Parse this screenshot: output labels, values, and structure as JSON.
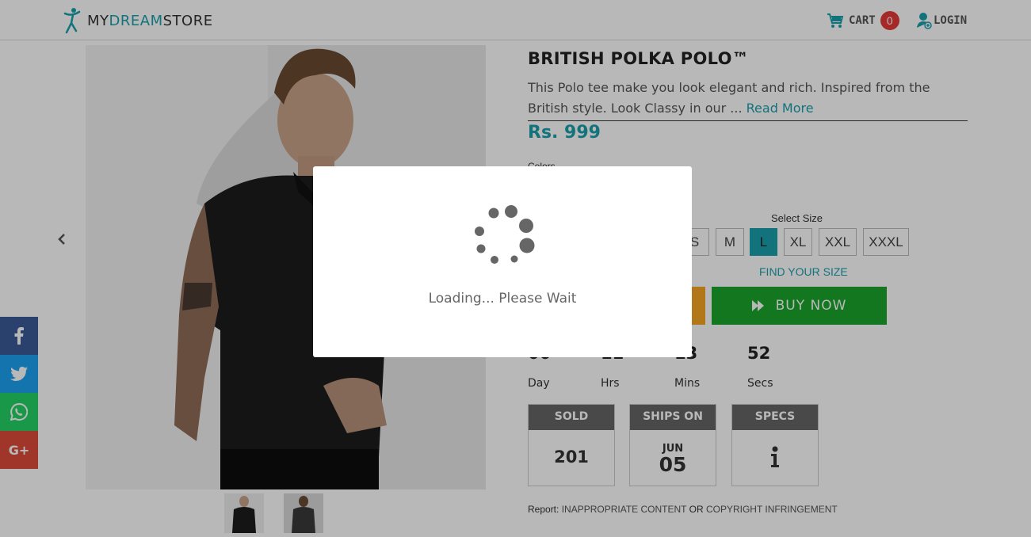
{
  "header": {
    "logo": {
      "my": "MY",
      "dream": "DREAM",
      "store": "STORE"
    },
    "cart_label": "CART",
    "cart_count": "0",
    "login_label": "LOGIN"
  },
  "product": {
    "title": "BRITISH POLKA POLO™",
    "description": "This Polo tee make you look elegant and rich. Inspired from the British style.  Look Classy in our ... ",
    "read_more": "Read More",
    "price": "Rs. 999",
    "colors_label": "Colors",
    "size_label": "Select Size",
    "sizes": [
      "S",
      "M",
      "L",
      "XL",
      "XXL",
      "XXXL"
    ],
    "selected_size": "L",
    "find_size": "FIND YOUR SIZE",
    "buy_now": "BUY NOW"
  },
  "timer": {
    "values": [
      "00",
      "11",
      "13",
      "52"
    ],
    "units": [
      "Day",
      "Hrs",
      "Mins",
      "Secs"
    ]
  },
  "info": {
    "sold_label": "SOLD",
    "sold_value": "201",
    "ships_label": "SHIPS ON",
    "ships_month": "JUN",
    "ships_day": "05",
    "specs_label": "SPECS"
  },
  "report": {
    "label": "Report:",
    "inappropriate": "INAPPROPRIATE CONTENT",
    "or": "OR",
    "copyright": "COPYRIGHT INFRINGEMENT"
  },
  "social": [
    "facebook-icon",
    "twitter-icon",
    "whatsapp-icon",
    "google-plus-icon"
  ],
  "modal": {
    "loading_text": "Loading... Please Wait"
  },
  "colors": {
    "accent": "#19a0ad",
    "buy_now": "#19a52b",
    "add_cart": "#f6a623",
    "cart_badge": "#e53935"
  }
}
